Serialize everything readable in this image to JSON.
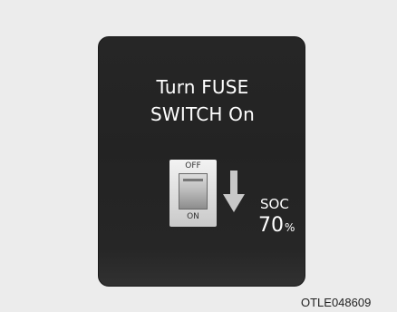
{
  "message": {
    "line1": "Turn FUSE",
    "line2": "SWITCH On"
  },
  "switch": {
    "off_label": "OFF",
    "on_label": "ON",
    "icon": "fuse-switch-icon"
  },
  "arrow": {
    "icon": "down-arrow-icon"
  },
  "soc": {
    "label": "SOC",
    "value": "70",
    "unit": "%"
  },
  "image_code": "OTLE048609",
  "colors": {
    "background": "#ececec",
    "panel": "#242424",
    "text": "#ffffff"
  }
}
